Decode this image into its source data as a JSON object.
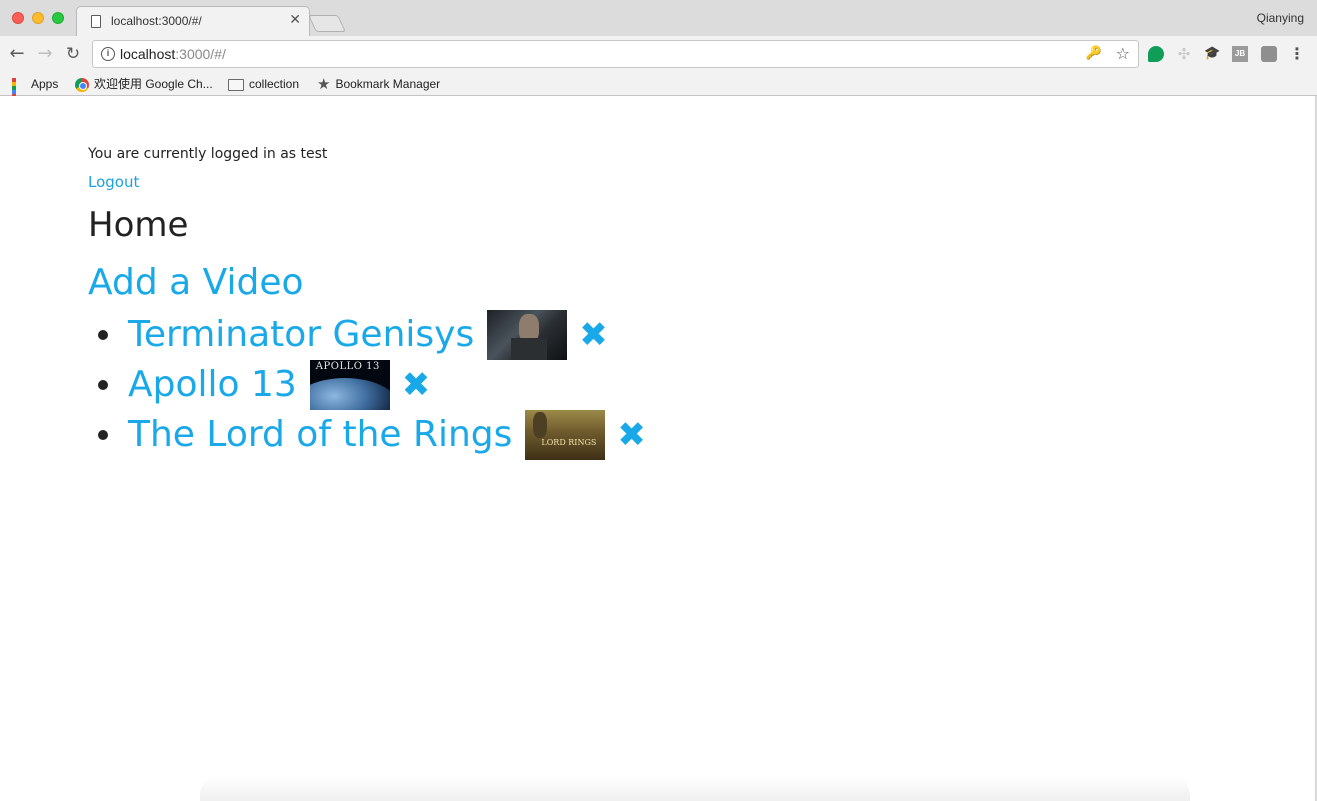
{
  "browser": {
    "tab_title": "localhost:3000/#/",
    "profile_name": "Qianying",
    "url_host": "localhost",
    "url_path": ":3000/#/",
    "bookmarks": [
      {
        "label": "Apps",
        "icon": "apps-grid-icon"
      },
      {
        "label": "欢迎使用 Google Ch...",
        "icon": "chrome-icon"
      },
      {
        "label": "collection",
        "icon": "folder-icon"
      },
      {
        "label": "Bookmark Manager",
        "icon": "star-icon"
      }
    ]
  },
  "page": {
    "login_status": "You are currently logged in as test",
    "logout_label": "Logout",
    "heading": "Home",
    "add_video_label": "Add a Video",
    "videos": [
      {
        "title": "Terminator Genisys",
        "thumbnail": "terminator-genisys-thumbnail",
        "delete_icon": "delete-x-icon"
      },
      {
        "title": "Apollo 13",
        "thumbnail": "apollo-13-thumbnail",
        "thumbnail_text": "APOLLO 13",
        "delete_icon": "delete-x-icon"
      },
      {
        "title": "The Lord of the Rings",
        "thumbnail": "lord-of-the-rings-thumbnail",
        "thumbnail_text": "LORD RINGS",
        "delete_icon": "delete-x-icon"
      }
    ]
  },
  "colors": {
    "link": "#1aa9e8",
    "text": "#222222"
  }
}
